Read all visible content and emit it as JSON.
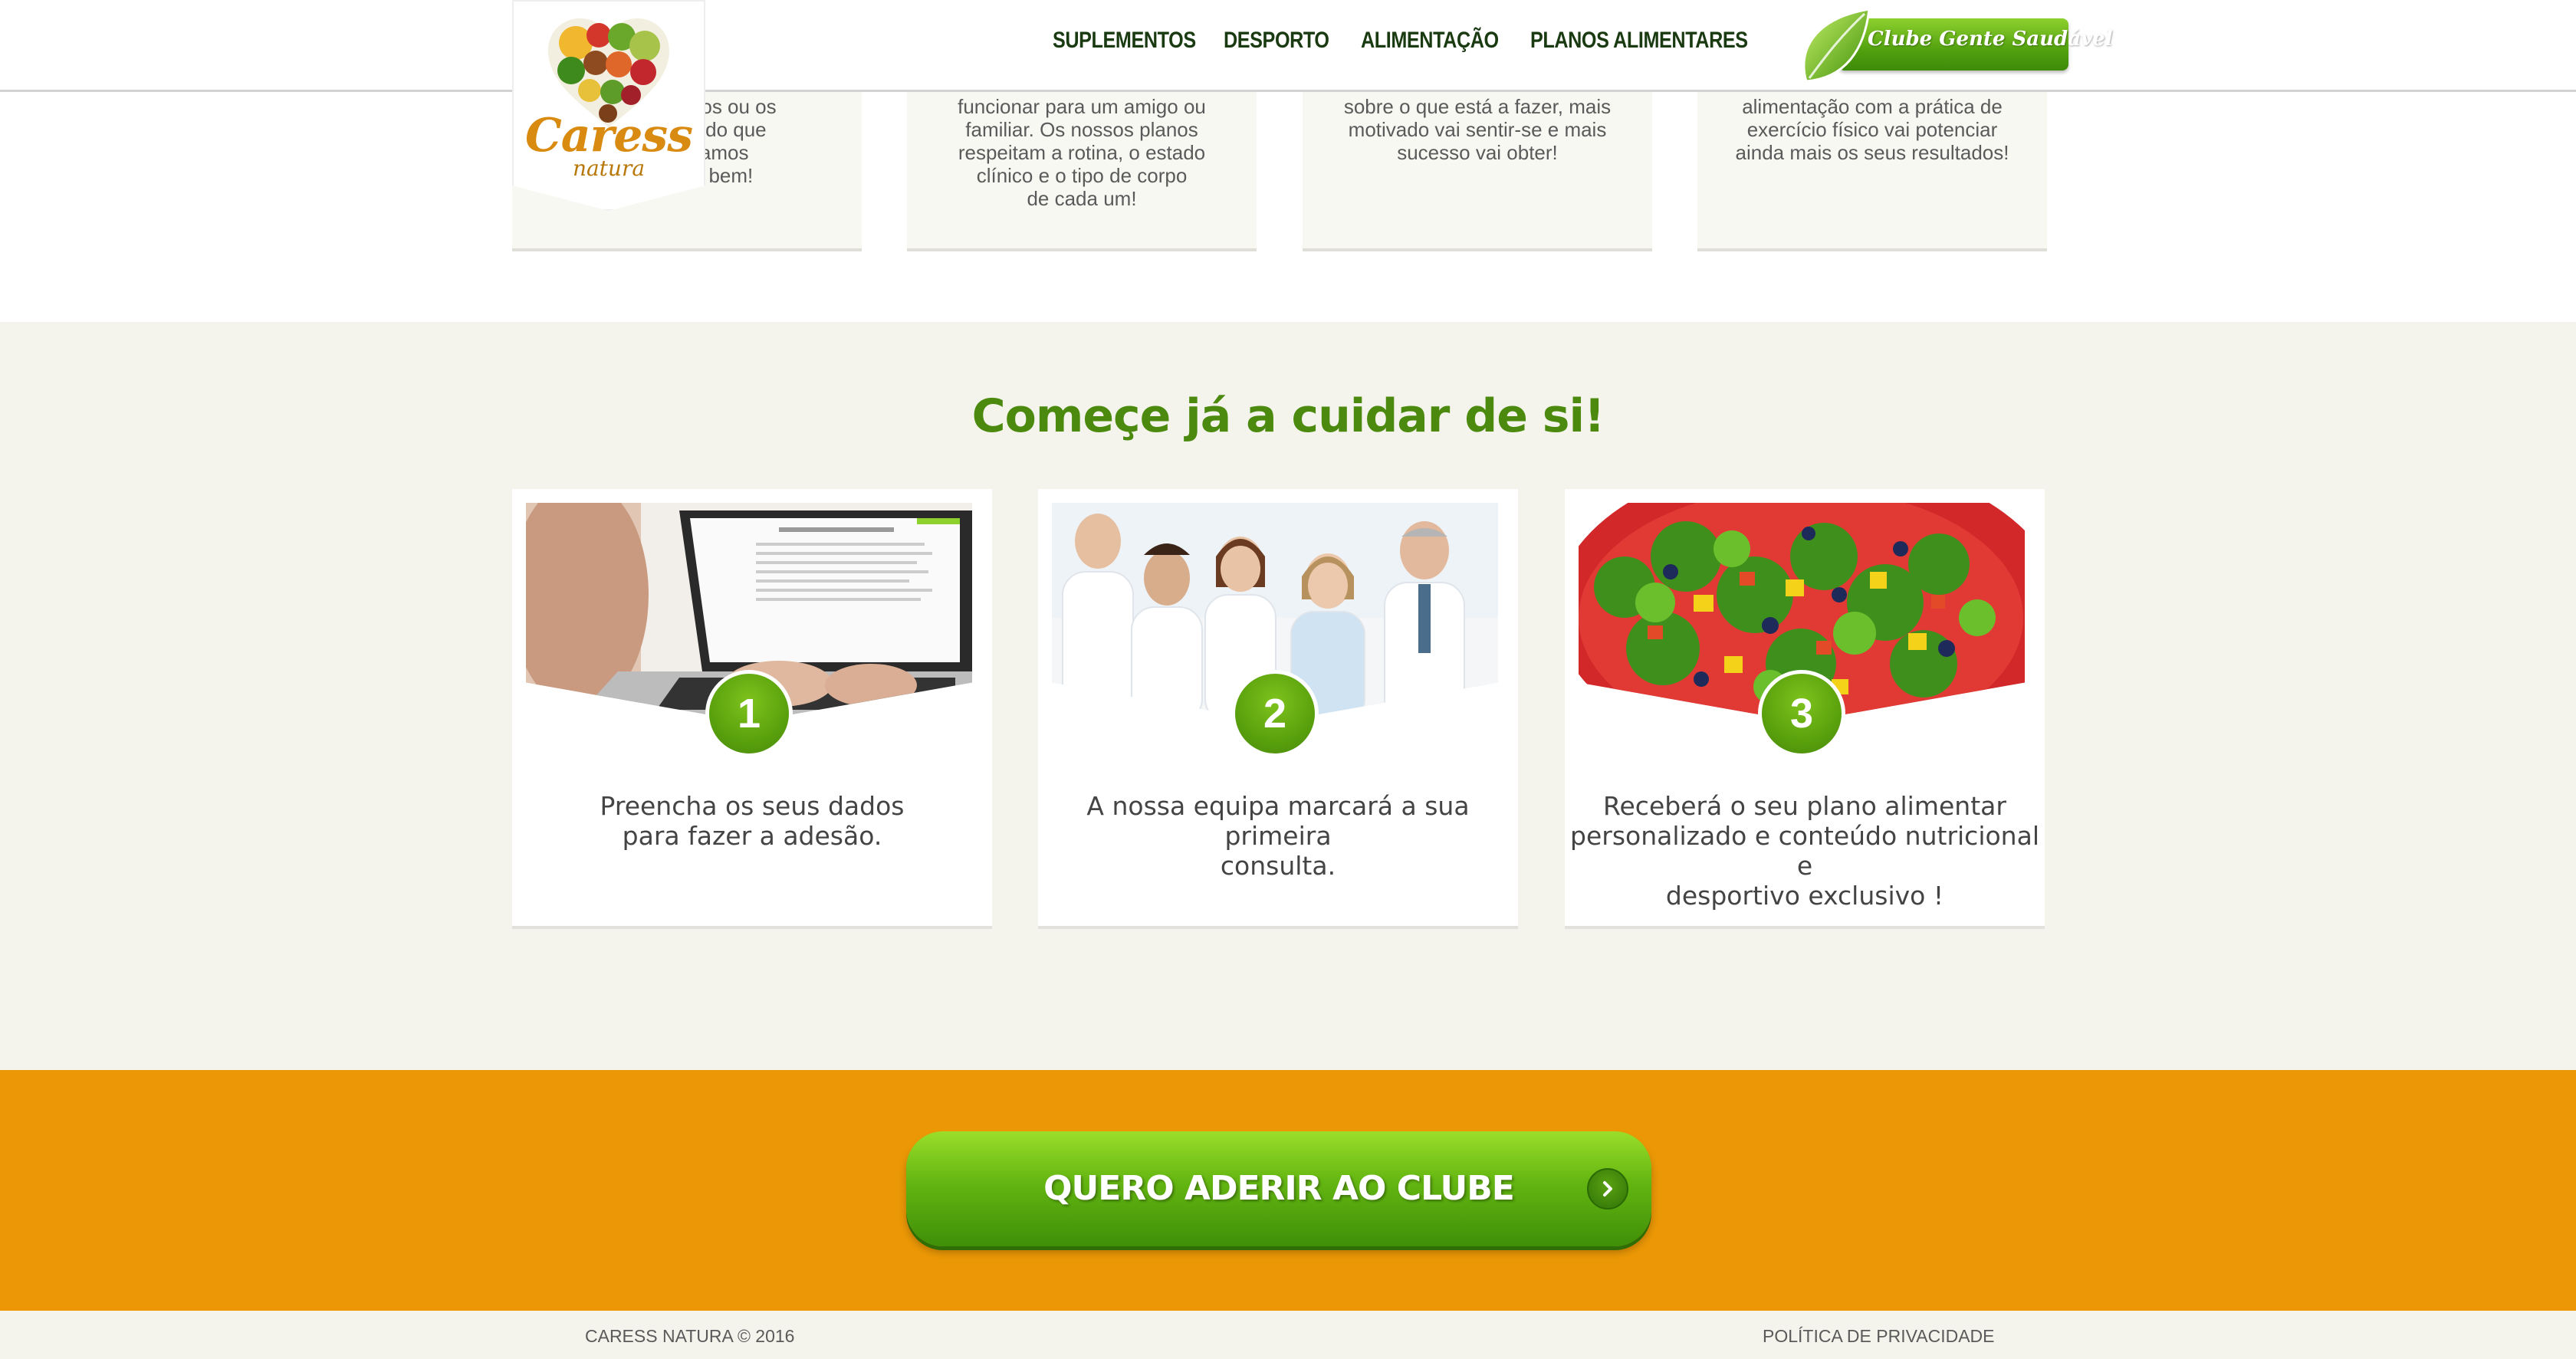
{
  "brand": {
    "name": "Caress",
    "tagline": "natura"
  },
  "nav": {
    "items": [
      {
        "label": "SUPLEMENTOS"
      },
      {
        "label": "DESPORTO"
      },
      {
        "label": "ALIMENTAÇÃO"
      },
      {
        "label": "PLANOS ALIMENTARES"
      }
    ],
    "club_button": "Clube Gente Saudável"
  },
  "intro_cards": [
    {
      "text": "amigos ou os\nMais do que\nes, vamos\nomer bem!"
    },
    {
      "text": "funcionar para um amigo ou\nfamiliar. Os nossos planos\nrespeitam a rotina, o estado\nclínico e o tipo de corpo\nde cada um!"
    },
    {
      "text": "sobre o que está a fazer, mais\nmotivado vai sentir-se e mais\nsucesso vai obter!"
    },
    {
      "text": "alimentação com a prática de\nexercício físico vai potenciar\nainda mais os seus resultados!"
    }
  ],
  "steps": {
    "title": "Começe já a cuidar de si!",
    "items": [
      {
        "number": "1",
        "text": "Preencha os seus dados\npara fazer a adesão.",
        "image": "laptop-typing-photo"
      },
      {
        "number": "2",
        "text": "A nossa equipa marcará a sua primeira\nconsulta.",
        "image": "medical-team-photo"
      },
      {
        "number": "3",
        "text": "Receberá o seu plano alimentar\npersonalizado e conteúdo nutricional e\ndesportivo exclusivo !",
        "image": "salad-bowl-photo"
      }
    ]
  },
  "cta": {
    "label": "QUERO ADERIR AO CLUBE",
    "icon": "chevron-right-icon"
  },
  "footer": {
    "copyright": "CARESS NATURA © 2016",
    "privacy": "POLÍTICA DE PRIVACIDADE"
  },
  "colors": {
    "brand_green": "#4b8a0e",
    "cta_orange": "#ec9806",
    "nav_text": "#1a3a12",
    "section_bg": "#f4f4ec"
  }
}
